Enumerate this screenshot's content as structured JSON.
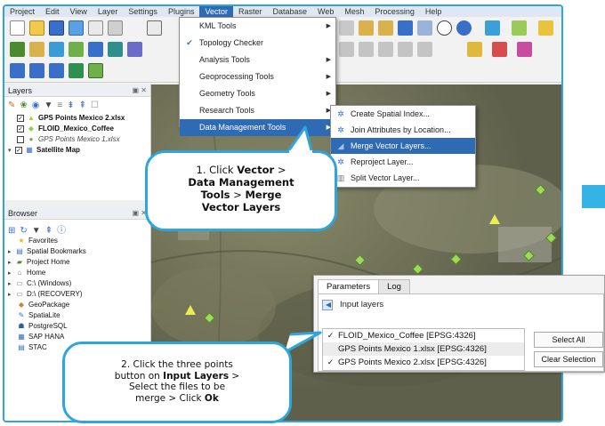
{
  "menubar": [
    "Project",
    "Edit",
    "View",
    "Layer",
    "Settings",
    "Plugins",
    "Vector",
    "Raster",
    "Database",
    "Web",
    "Mesh",
    "Processing",
    "Help"
  ],
  "vector_menu": [
    {
      "label": "KML Tools",
      "icon": "kml-icon",
      "submenu": true
    },
    {
      "label": "Topology Checker",
      "icon": "topology-icon",
      "submenu": false
    },
    {
      "label": "Analysis Tools",
      "icon": "",
      "submenu": true
    },
    {
      "label": "Geoprocessing Tools",
      "icon": "",
      "submenu": true
    },
    {
      "label": "Geometry Tools",
      "icon": "",
      "submenu": true
    },
    {
      "label": "Research Tools",
      "icon": "",
      "submenu": true
    },
    {
      "label": "Data Management Tools",
      "icon": "",
      "submenu": true,
      "highlighted": true
    }
  ],
  "data_mgmt_menu": [
    {
      "label": "Create Spatial Index...",
      "icon": "gear-icon"
    },
    {
      "label": "Join Attributes by Location...",
      "icon": "gear-icon"
    },
    {
      "label": "Merge Vector Layers...",
      "icon": "merge-icon",
      "highlighted": true
    },
    {
      "label": "Reproject Layer...",
      "icon": "gear-icon"
    },
    {
      "label": "Split Vector Layer...",
      "icon": "split-icon"
    }
  ],
  "layers_panel": {
    "title": "Layers",
    "items": [
      {
        "label": "GPS Points Mexico 2.xlsx",
        "checked": true,
        "symbol": "triangle",
        "bold": true
      },
      {
        "label": "FLOID_Mexico_Coffee",
        "checked": true,
        "symbol": "diamond",
        "bold": true
      },
      {
        "label": "GPS Points Mexico 1.xlsx",
        "checked": false,
        "symbol": "circle",
        "italic": true
      },
      {
        "label": "Satellite Map",
        "checked": true,
        "symbol": "raster",
        "bold": true
      }
    ]
  },
  "browser_panel": {
    "title": "Browser",
    "items": [
      {
        "label": "Favorites",
        "icon": "star-icon"
      },
      {
        "label": "Spatial Bookmarks",
        "icon": "bookmark-icon"
      },
      {
        "label": "Project Home",
        "icon": "folder-icon"
      },
      {
        "label": "Home",
        "icon": "folder-icon"
      },
      {
        "label": "C:\\ (Windows)",
        "icon": "drive-icon"
      },
      {
        "label": "D:\\ (RECOVERY)",
        "icon": "drive-icon"
      },
      {
        "label": "GeoPackage",
        "icon": "geopackage-icon"
      },
      {
        "label": "SpatiaLite",
        "icon": "spatialite-icon"
      },
      {
        "label": "PostgreSQL",
        "icon": "postgres-icon"
      },
      {
        "label": "SAP HANA",
        "icon": "database-icon"
      },
      {
        "label": "STAC",
        "icon": "database-icon"
      }
    ]
  },
  "callout1": {
    "l1a": "1. Click ",
    "l1b": "Vector",
    "l1c": " >",
    "l2": "Data Management",
    "l3a": "Tools",
    "l3b": " > ",
    "l3c": "Merge",
    "l4": "Vector Layers"
  },
  "callout2": {
    "l1": "2. Click the three points",
    "l2a": "button on ",
    "l2b": "Input Layers",
    "l2c": " >",
    "l3": "Select the files to be",
    "l4a": "merge > Click ",
    "l4b": "Ok"
  },
  "params_dialog": {
    "tabs": [
      "Parameters",
      "Log"
    ],
    "input_label": "Input layers",
    "layers": [
      {
        "label": "FLOID_Mexico_Coffee [EPSG:4326]",
        "checked": true
      },
      {
        "label": "GPS Points Mexico 1.xlsx [EPSG:4326]",
        "checked": false
      },
      {
        "label": "GPS Points Mexico 2.xlsx [EPSG:4326]",
        "checked": true
      }
    ],
    "select_all": "Select All",
    "clear_selection": "Clear Selection"
  },
  "check_mark": "✓",
  "colors": {
    "accent": "#2ea6dc",
    "highlight": "#2f6bb5",
    "map": "#6d6f58",
    "marker_green": "#9ed95a",
    "marker_yellow": "#e7ee52"
  }
}
